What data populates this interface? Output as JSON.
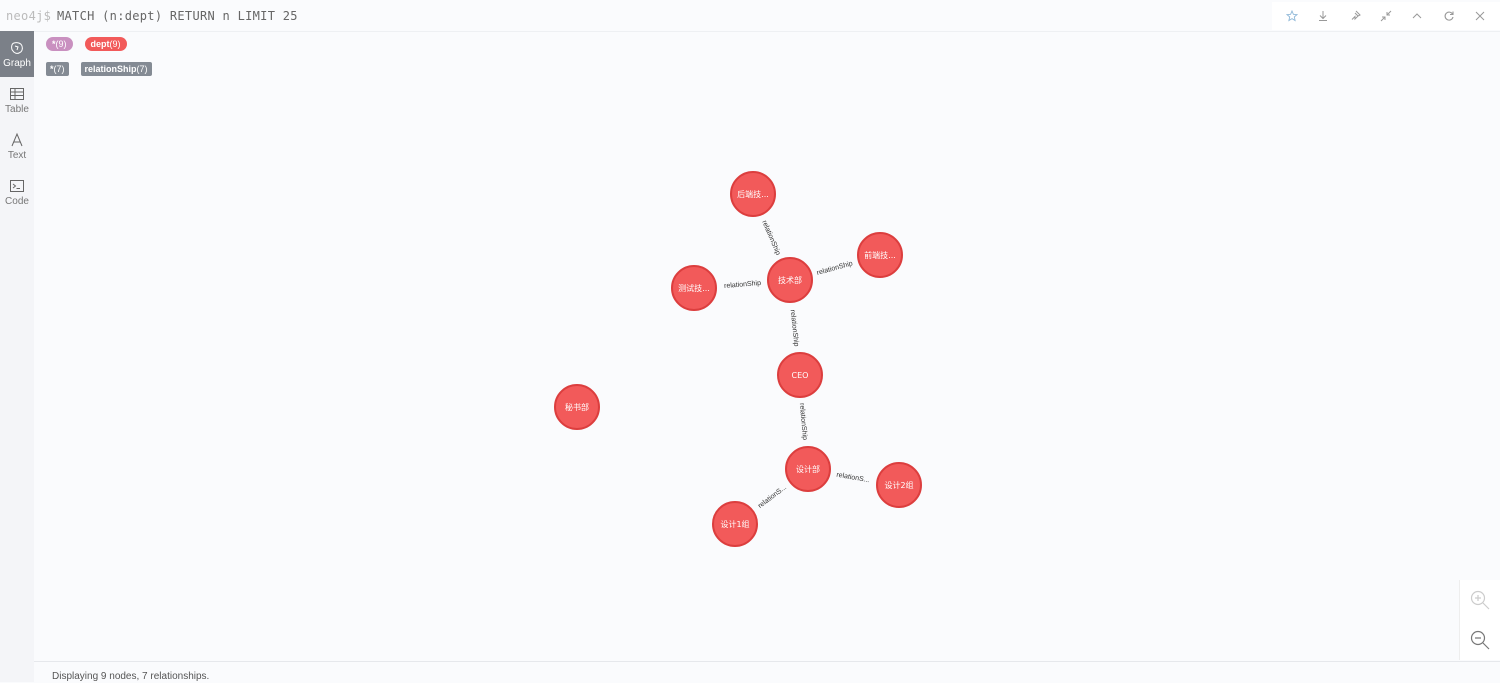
{
  "editor": {
    "prompt": "neo4j$",
    "query": "MATCH (n:dept) RETURN n LIMIT 25"
  },
  "actions": [
    {
      "name": "star-icon"
    },
    {
      "name": "download-icon"
    },
    {
      "name": "pin-icon"
    },
    {
      "name": "collapse-icon"
    },
    {
      "name": "chevron-up-icon"
    },
    {
      "name": "refresh-icon"
    },
    {
      "name": "close-icon"
    }
  ],
  "sidebar": {
    "items": [
      {
        "label": "Graph",
        "icon": "graph-icon",
        "active": true
      },
      {
        "label": "Table",
        "icon": "table-icon",
        "active": false
      },
      {
        "label": "Text",
        "icon": "text-icon",
        "active": false
      },
      {
        "label": "Code",
        "icon": "code-icon",
        "active": false
      }
    ]
  },
  "legend": {
    "node_all": {
      "label": "*",
      "count": "(9)",
      "color": "#c990c0"
    },
    "node_dept": {
      "label": "dept",
      "count": "(9)",
      "color": "#f25a5a"
    },
    "rel_all": {
      "label": "*",
      "count": "(7)"
    },
    "rel_type": {
      "label": "relationShip",
      "count": "(7)"
    }
  },
  "graph": {
    "node_color": "#f25a5a",
    "node_border": "#dc3e3e",
    "nodes": [
      {
        "id": "ceo",
        "label": "CEO"
      },
      {
        "id": "tech",
        "label": "技术部"
      },
      {
        "id": "backend",
        "label": "后端技..."
      },
      {
        "id": "frontend",
        "label": "前端技..."
      },
      {
        "id": "testing",
        "label": "测试技..."
      },
      {
        "id": "design",
        "label": "设计部"
      },
      {
        "id": "design1",
        "label": "设计1组"
      },
      {
        "id": "design2",
        "label": "设计2组"
      },
      {
        "id": "secretary",
        "label": "秘书部"
      }
    ],
    "relationships": [
      {
        "from": "ceo",
        "to": "tech",
        "label": "relationShip"
      },
      {
        "from": "tech",
        "to": "backend",
        "label": "relationShip"
      },
      {
        "from": "tech",
        "to": "frontend",
        "label": "relationShip"
      },
      {
        "from": "tech",
        "to": "testing",
        "label": "relationShip"
      },
      {
        "from": "ceo",
        "to": "design",
        "label": "relationShip"
      },
      {
        "from": "design",
        "to": "design1",
        "label": "relationS..."
      },
      {
        "from": "design",
        "to": "design2",
        "label": "relationS..."
      }
    ]
  },
  "status": {
    "text": "Displaying 9 nodes, 7 relationships."
  }
}
